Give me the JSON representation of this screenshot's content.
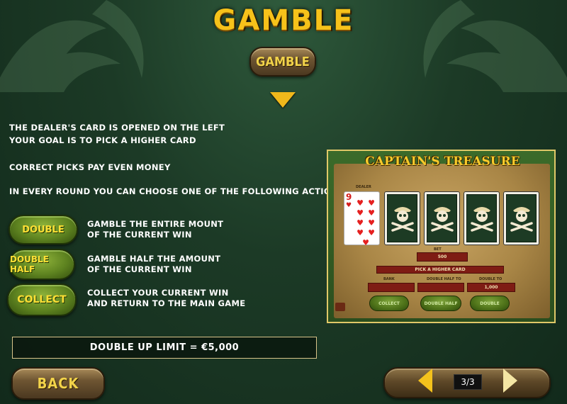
{
  "page": {
    "title": "GAMBLE",
    "gamble_button": "GAMBLE"
  },
  "info": {
    "line1": "THE DEALER'S CARD IS OPENED ON THE LEFT",
    "line2": "YOUR GOAL IS TO PICK A HIGHER CARD",
    "line3": "CORRECT PICKS PAY EVEN MONEY",
    "line4": "IN EVERY ROUND YOU CAN CHOOSE ONE OF THE FOLLOWING ACTIONS:"
  },
  "actions": [
    {
      "label": "DOUBLE",
      "desc1": "GAMBLE THE ENTIRE MOUNT",
      "desc2": "OF THE CURRENT WIN"
    },
    {
      "label": "DOUBLE HALF",
      "desc1": "GAMBLE HALF THE AMOUNT",
      "desc2": "OF THE CURRENT WIN"
    },
    {
      "label": "COLLECT",
      "desc1": "COLLECT YOUR CURRENT WIN",
      "desc2": "AND RETURN TO THE MAIN GAME"
    }
  ],
  "limit": "DOUBLE UP LIMIT = €5,000",
  "nav": {
    "back": "BACK",
    "page_indicator": "3/3",
    "prev_icon": "arrow-left-icon",
    "next_icon": "arrow-right-icon"
  },
  "preview": {
    "title": "CAPTAIN'S TREASURE",
    "dealer_label": "DEALER",
    "dealer_card_rank": "9",
    "dealer_card_suit": "♥",
    "card_back_icon": "skull-crossbones-icon",
    "bet_label": "BET",
    "bet_value": "500",
    "prompt": "PICK A HIGHER CARD",
    "bank_label": "BANK",
    "double_half_to_label": "DOUBLE HALF TO",
    "double_to_label": "DOUBLE TO",
    "double_to_value": "1,000",
    "buttons": [
      "COLLECT",
      "DOUBLE HALF",
      "DOUBLE"
    ]
  },
  "colors": {
    "gold": "#f6c21a",
    "background": "#1c3a26",
    "green_button": "#5e8320",
    "wood_button": "#6e5532"
  }
}
